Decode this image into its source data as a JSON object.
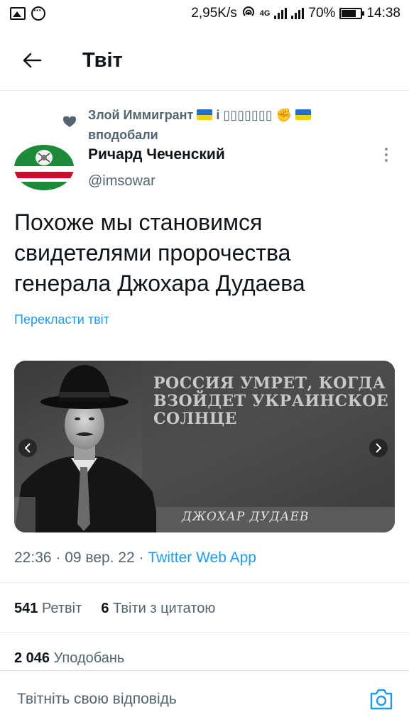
{
  "status_bar": {
    "network_speed": "2,95K/s",
    "network_type": "4G",
    "battery": "70%",
    "time": "14:38"
  },
  "header": {
    "title": "Твіт"
  },
  "social_context": {
    "liked_by": "Злой Иммигрант",
    "connector": "і",
    "other_name": "▯▯▯▯▯▯▯",
    "action": "вподобали"
  },
  "author": {
    "name": "Ричард Чеченский",
    "handle": "@imsowar"
  },
  "tweet": {
    "text": "Похоже мы становимся свидетелями пророчества генерала Джохара Дудаева",
    "translate_label": "Перекласти твіт",
    "media": {
      "quote": "РОССИЯ УМРЕТ, КОГДА ВЗОЙДЕТ УКРАИНСКОЕ СОЛНЦЕ",
      "signature": "ДЖОХАР ДУДАЕВ"
    },
    "time": "22:36",
    "date": "09 вер. 22",
    "source": "Twitter Web App"
  },
  "stats": {
    "retweets_count": "541",
    "retweets_label": "Ретвіт",
    "quotes_count": "6",
    "quotes_label": "Твіти з цитатою",
    "likes_count": "2 046",
    "likes_label": "Уподобань"
  },
  "reply": {
    "placeholder": "Твітніть свою відповідь"
  },
  "colors": {
    "accent": "#1d9bf0",
    "secondary_text": "#536471",
    "primary_text": "#0f1419"
  }
}
